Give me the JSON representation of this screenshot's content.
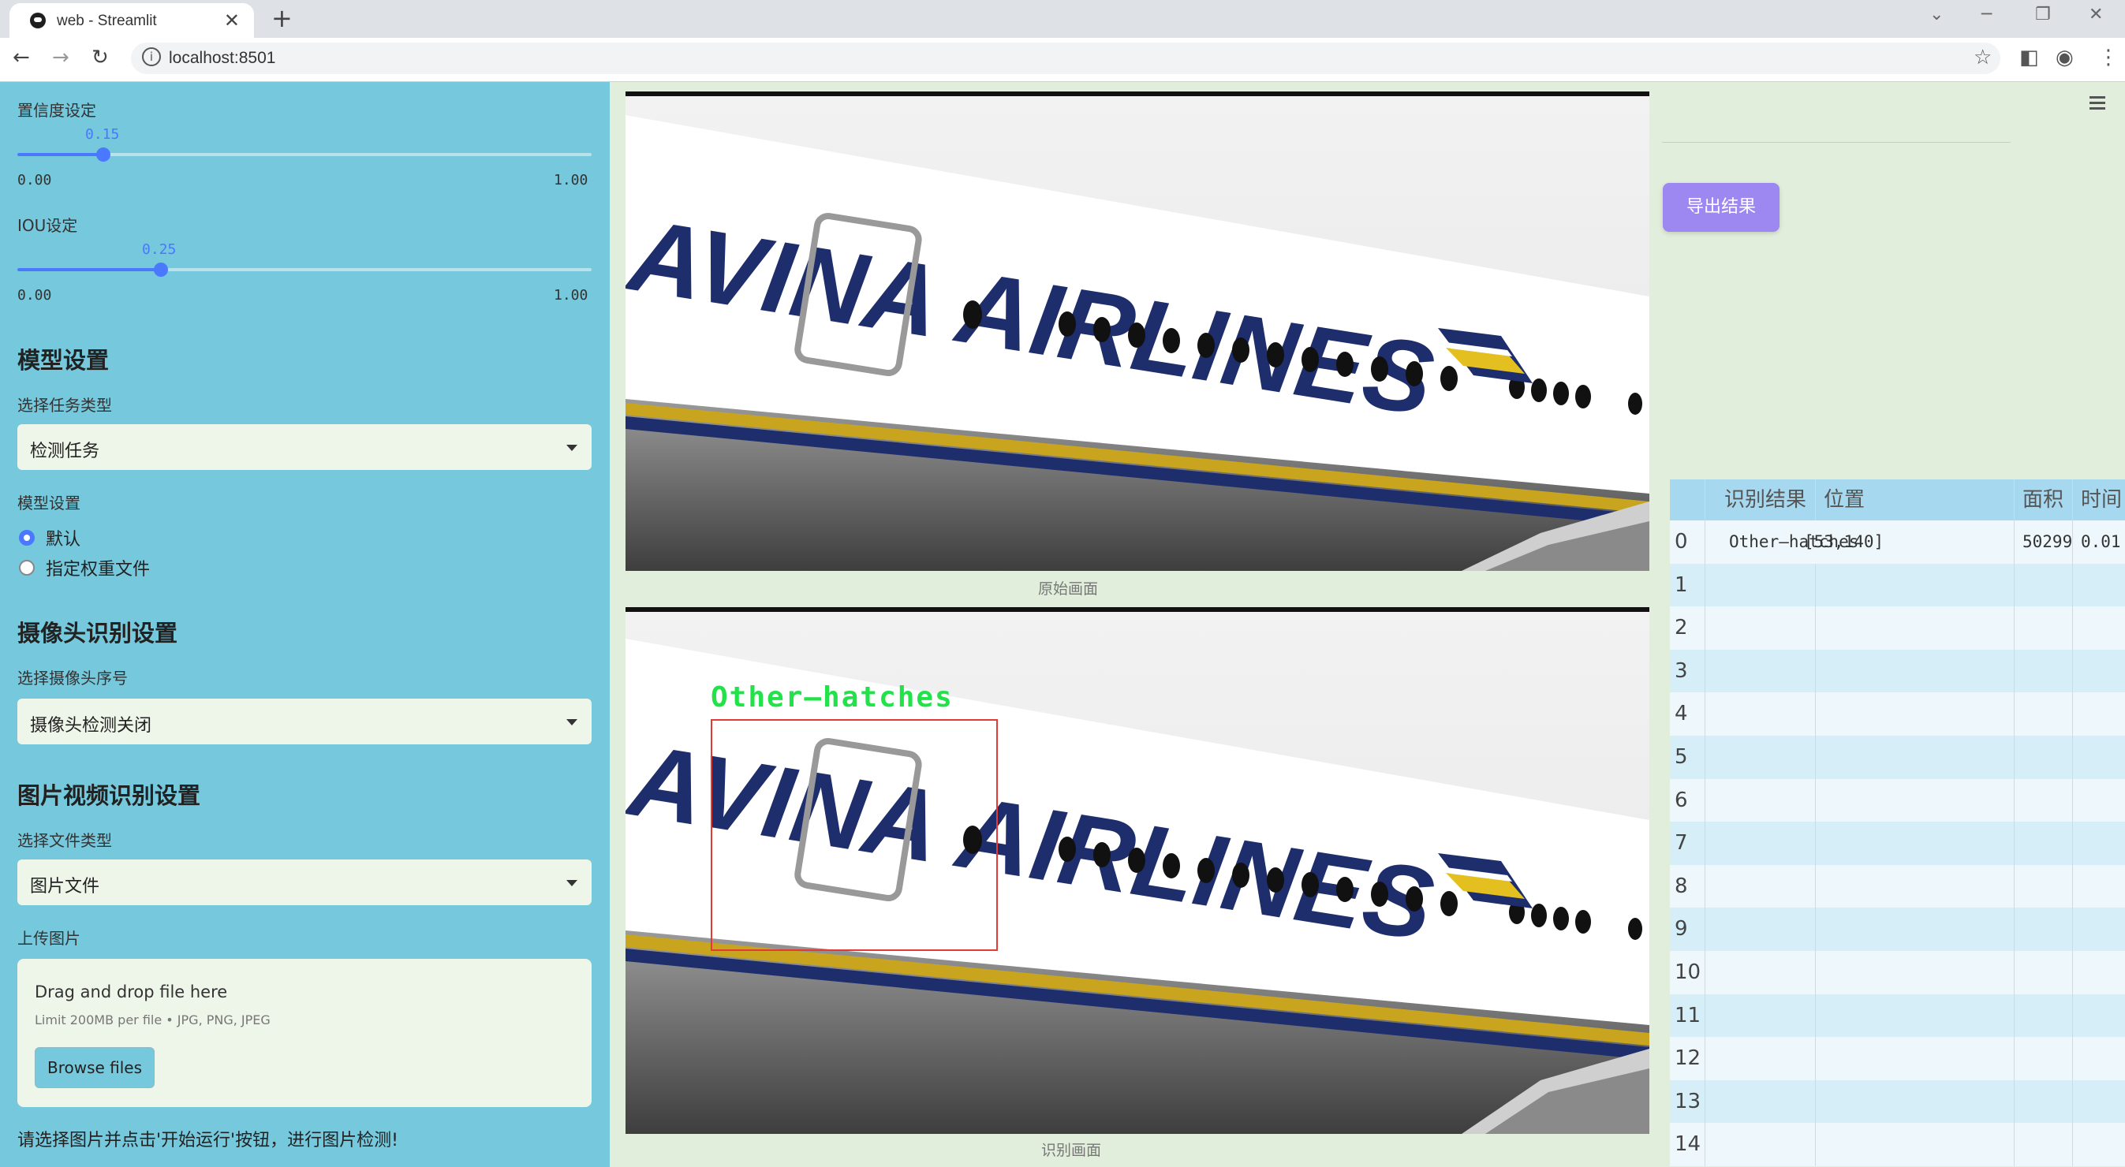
{
  "browser": {
    "tab_title": "web - Streamlit",
    "tab_close": "✕",
    "new_tab": "+",
    "url": "localhost:8501",
    "back_icon": "←",
    "forward_icon": "→",
    "reload_icon": "↻",
    "minimize_icon": "─",
    "restore_icon": "❐",
    "close_icon": "✕",
    "dropdown_icon": "⌄",
    "bookmark_icon": "☆",
    "sidepanel_icon": "◧",
    "profile_icon": "◉",
    "menu_icon": "⋮"
  },
  "sidebar": {
    "confidence": {
      "label": "置信度设定",
      "value": "0.15",
      "min": "0.00",
      "max": "1.00",
      "fraction": 0.15
    },
    "iou": {
      "label": "IOU设定",
      "value": "0.25",
      "min": "0.00",
      "max": "1.00",
      "fraction": 0.25
    },
    "model_settings": {
      "header": "模型设置",
      "task_label": "选择任务类型",
      "task_value": "检测任务",
      "model_label": "模型设置",
      "options": [
        "默认",
        "指定权重文件"
      ],
      "selected": 0
    },
    "camera": {
      "header": "摄像头识别设置",
      "select_label": "选择摄像头序号",
      "select_value": "摄像头检测关闭"
    },
    "media": {
      "header": "图片视频识别设置",
      "type_label": "选择文件类型",
      "type_value": "图片文件",
      "upload_label": "上传图片",
      "drop_text": "Drag and drop file here",
      "limit_text": "Limit 200MB per file • JPG, PNG, JPEG",
      "browse_label": "Browse files"
    },
    "hint": "请选择图片并点击'开始运行'按钮，进行图片检测!"
  },
  "main": {
    "original_caption": "原始画面",
    "result_caption": "识别画面",
    "detection_label": "Other—hatches",
    "scene_text": "AVINA AIRLINES",
    "export_label": "导出结果",
    "colors": {
      "sidebar": "#76c8dc",
      "main": "#e2eedc",
      "accent": "#4a78ff",
      "export": "#9c88f0",
      "box": "#e53935",
      "label": "#22e24a"
    }
  },
  "table": {
    "headers": [
      "",
      "识别结果",
      "位置",
      "面积",
      "时间"
    ],
    "rows": [
      {
        "idx": "0",
        "result": "Other—hatches",
        "position": "[53,140]",
        "area": "50299",
        "time": "0.01"
      },
      {
        "idx": "1"
      },
      {
        "idx": "2"
      },
      {
        "idx": "3"
      },
      {
        "idx": "4"
      },
      {
        "idx": "5"
      },
      {
        "idx": "6"
      },
      {
        "idx": "7"
      },
      {
        "idx": "8"
      },
      {
        "idx": "9"
      },
      {
        "idx": "10"
      },
      {
        "idx": "11"
      },
      {
        "idx": "12"
      },
      {
        "idx": "13"
      },
      {
        "idx": "14"
      }
    ]
  }
}
